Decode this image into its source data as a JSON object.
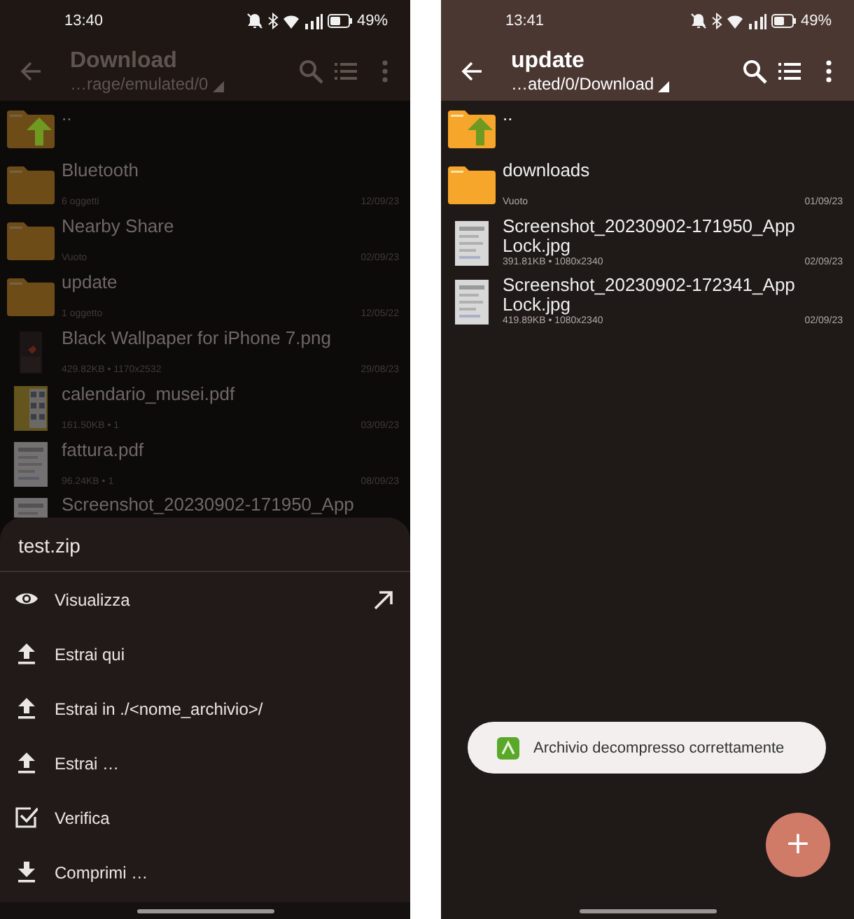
{
  "screens": [
    {
      "status_bar": {
        "time": "13:40",
        "battery": "49%"
      },
      "app_bar": {
        "title": "Download",
        "path": "…rage/emulated/0"
      },
      "files": [
        {
          "kind": "parent",
          "name": ".."
        },
        {
          "kind": "folder",
          "name": "Bluetooth",
          "info": "6 oggetti",
          "date": "12/09/23"
        },
        {
          "kind": "folder",
          "name": "Nearby Share",
          "info": "Vuoto",
          "date": "02/09/23"
        },
        {
          "kind": "folder",
          "name": "update",
          "info": "1 oggetto",
          "date": "12/05/22"
        },
        {
          "name": "Black Wallpaper for iPhone 7.png",
          "info": "429.82KB  • 1170x2532",
          "date": "29/08/23"
        },
        {
          "kind": "pdf",
          "name": "calendario_musei.pdf",
          "info": "161.50KB  • 1",
          "date": "03/09/23"
        },
        {
          "kind": "pdf",
          "name": "fattura.pdf",
          "info": "96.24KB  • 1",
          "date": "08/09/23"
        },
        {
          "name": "Screenshot_20230902-171950_App"
        }
      ],
      "sheet": {
        "title": "test.zip",
        "actions": [
          {
            "kind": "view",
            "label": "Visualizza",
            "external": true
          },
          {
            "kind": "extract",
            "label": "Estrai qui",
            "external": false
          },
          {
            "kind": "extract",
            "label": "Estrai in ./<nome_archivio>/",
            "external": false
          },
          {
            "kind": "extract",
            "label": "Estrai …",
            "external": false
          },
          {
            "kind": "verify",
            "label": "Verifica",
            "external": false
          },
          {
            "kind": "compress",
            "label": "Comprimi …",
            "external": false
          }
        ]
      }
    },
    {
      "status_bar": {
        "time": "13:41",
        "battery": "49%"
      },
      "app_bar": {
        "title": "update",
        "path": "…ated/0/Download"
      },
      "files": [
        {
          "kind": "parent",
          "name": ".."
        },
        {
          "kind": "folder",
          "name": "downloads",
          "info": "Vuoto",
          "date": "01/09/23"
        },
        {
          "name": "Screenshot_20230902-171950_App Lock.jpg",
          "info": "391.81KB  • 1080x2340",
          "date": "02/09/23"
        },
        {
          "name": "Screenshot_20230902-172341_App Lock.jpg",
          "info": "419.89KB  • 1080x2340",
          "date": "02/09/23"
        }
      ],
      "toast": {
        "text": "Archivio decompresso correttamente"
      },
      "fab": {
        "label": "+"
      }
    }
  ]
}
